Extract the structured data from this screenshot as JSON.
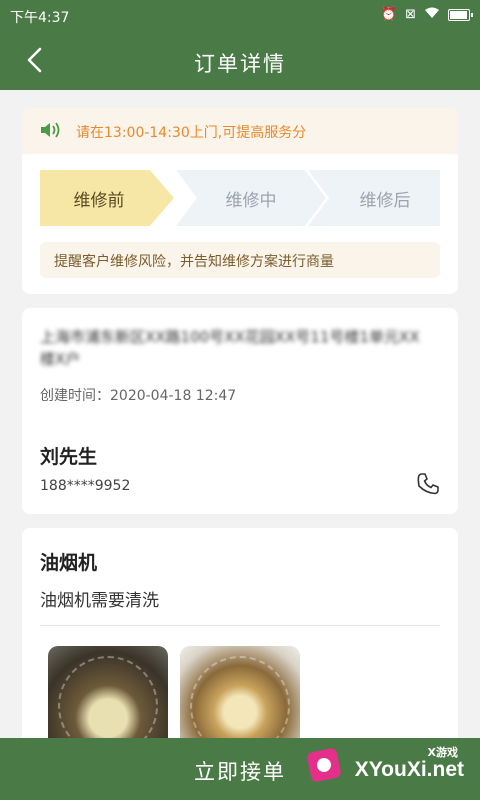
{
  "status_bar": {
    "time": "下午4:37"
  },
  "header": {
    "title": "订单详情"
  },
  "notice": {
    "text": "请在13:00-14:30上门,可提高服务分"
  },
  "steps": [
    {
      "label": "维修前",
      "state": "active"
    },
    {
      "label": "维修中",
      "state": "pending"
    },
    {
      "label": "维修后",
      "state": "pending"
    }
  ],
  "tip": {
    "text": "提醒客户维修风险，并告知维修方案进行商量"
  },
  "order": {
    "address": "上海市浦东新区XX路100号XX花园XX号11号楼1单元XX楼X户",
    "created_label": "创建时间：",
    "created_time": "2020-04-18 12:47",
    "customer_name": "刘先生",
    "customer_phone": "188****9952"
  },
  "service": {
    "name": "油烟机",
    "description": "油烟机需要清洗",
    "photos": [
      "range-hood-photo-1",
      "range-hood-photo-2"
    ]
  },
  "bottom_bar": {
    "accept_label": "立即接单"
  },
  "watermark": {
    "cn": "X游戏",
    "en": "XYouXi.net"
  },
  "colors": {
    "primary": "#4a7a46",
    "notice_text": "#e8892e",
    "step_active": "#f7e7a7",
    "step_inactive": "#eef3f8"
  }
}
